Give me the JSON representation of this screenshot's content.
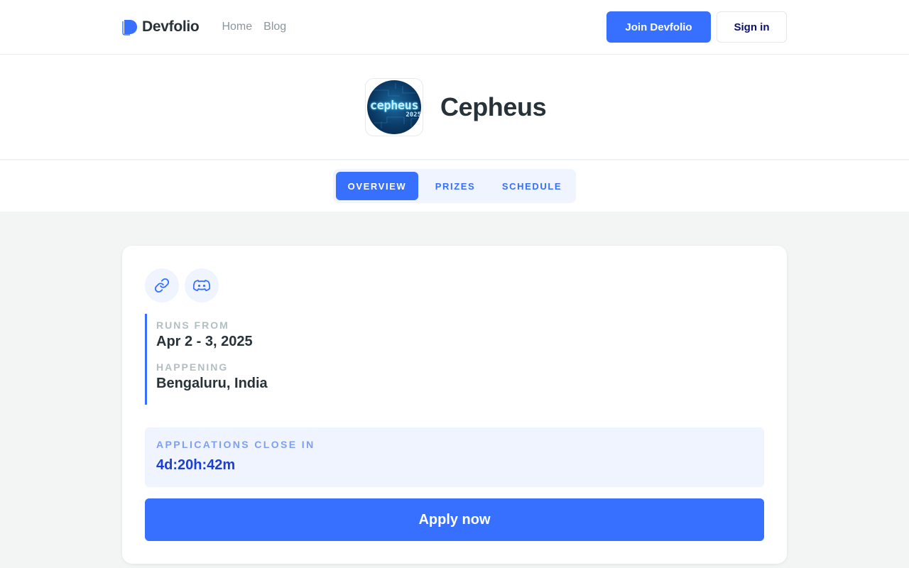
{
  "nav": {
    "brand": "Devfolio",
    "links": [
      {
        "label": "Home"
      },
      {
        "label": "Blog"
      }
    ],
    "join_label": "Join Devfolio",
    "signin_label": "Sign in"
  },
  "hackathon": {
    "name": "Cepheus",
    "logo_text": "cepheus",
    "logo_year": "2025"
  },
  "tabs": [
    {
      "label": "OVERVIEW",
      "active": true
    },
    {
      "label": "PRIZES",
      "active": false
    },
    {
      "label": "SCHEDULE",
      "active": false
    }
  ],
  "overview": {
    "icons": [
      "link-icon",
      "discord-icon"
    ],
    "runs_from_label": "RUNS FROM",
    "runs_from_value": "Apr 2 - 3, 2025",
    "happening_label": "HAPPENING",
    "happening_value": "Bengaluru, India",
    "deadline_label": "APPLICATIONS CLOSE IN",
    "deadline_value": "4d:20h:42m",
    "apply_label": "Apply now"
  },
  "colors": {
    "accent": "#3770ff",
    "accent_soft": "#eff4ff",
    "page_bg": "#f3f5f5",
    "text_dark": "#273339",
    "deadline_text": "#1c3fd1"
  }
}
